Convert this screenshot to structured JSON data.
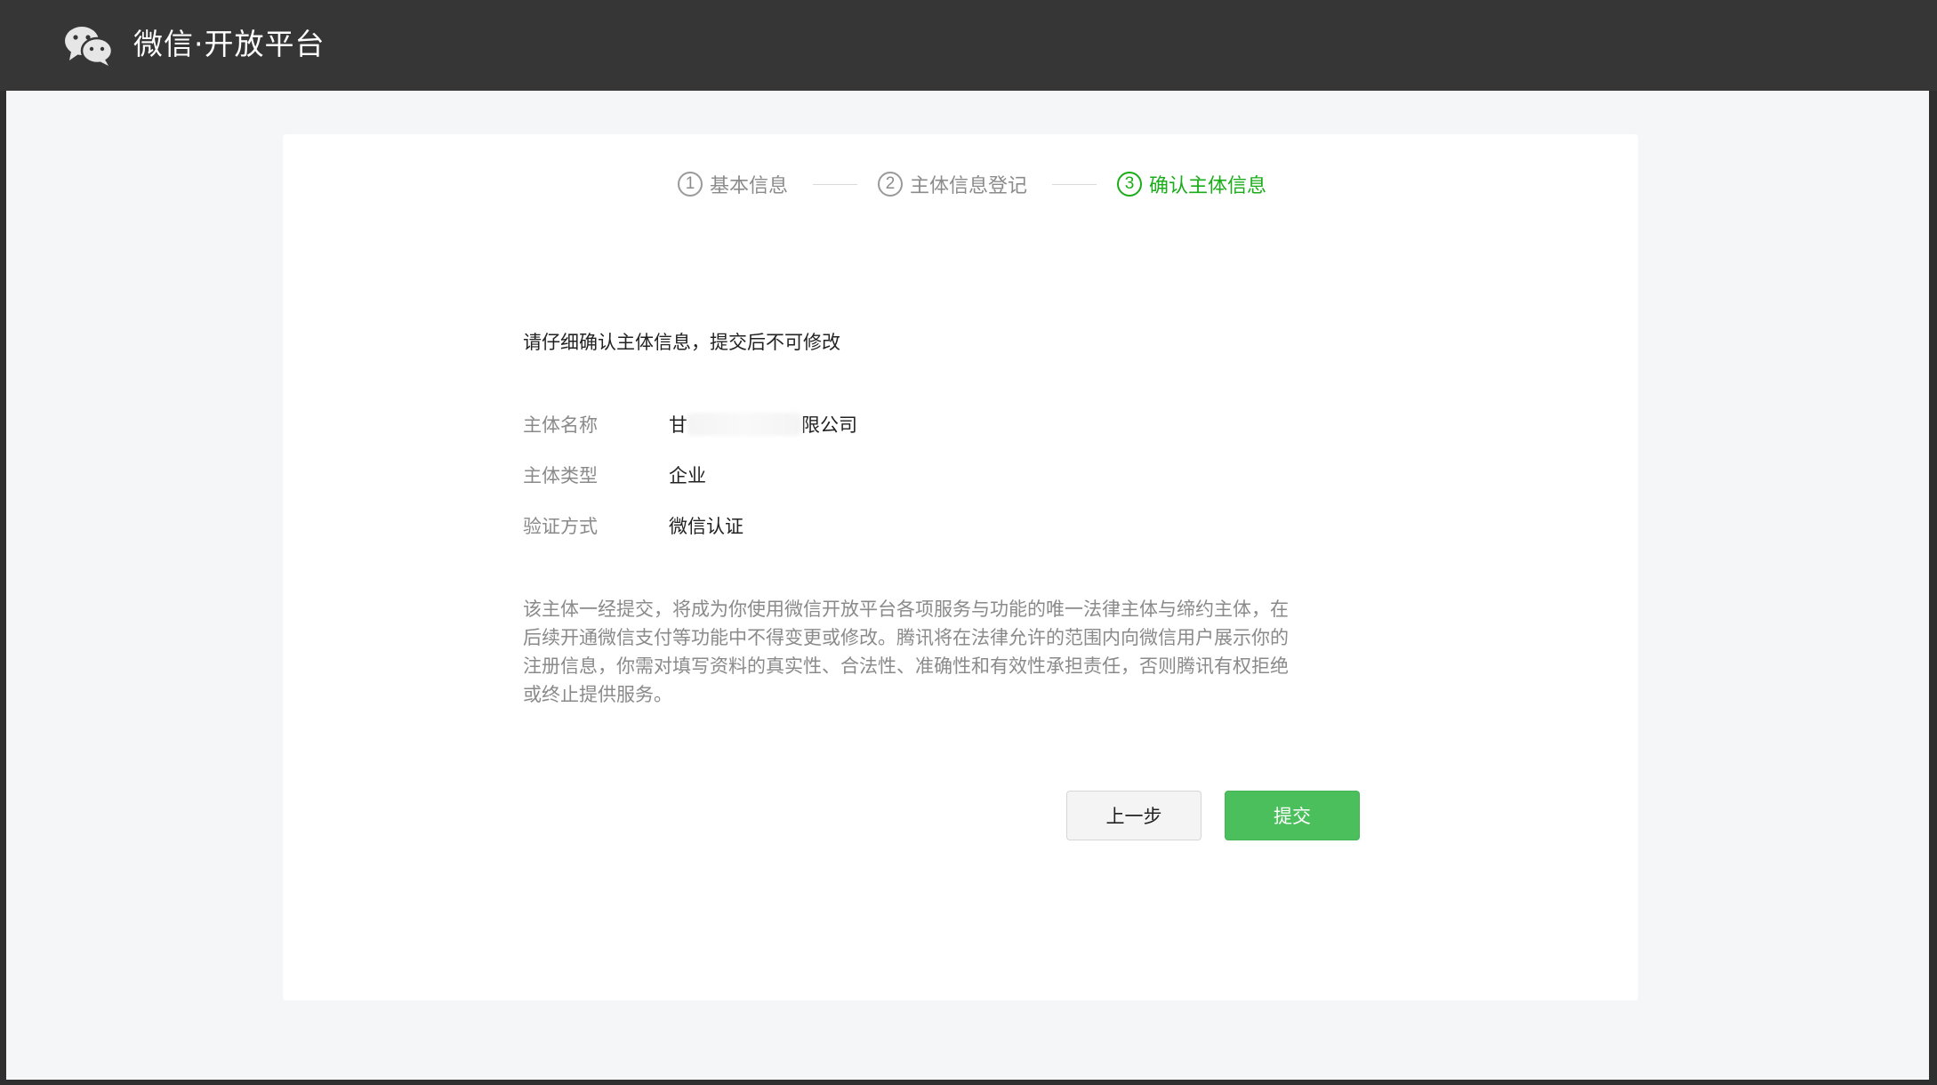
{
  "header": {
    "brand": "微信·开放平台",
    "logo_icon": "wechat-logo-icon"
  },
  "stepper": {
    "steps": [
      {
        "num": "1",
        "label": "基本信息",
        "state": "done"
      },
      {
        "num": "2",
        "label": "主体信息登记",
        "state": "done"
      },
      {
        "num": "3",
        "label": "确认主体信息",
        "state": "active"
      }
    ],
    "active_color": "#1aad19"
  },
  "confirm": {
    "notice": "请仔细确认主体信息，提交后不可修改",
    "fields": [
      {
        "label": "主体名称",
        "value_prefix": "甘",
        "value_suffix": "限公司"
      },
      {
        "label": "主体类型",
        "value": "企业"
      },
      {
        "label": "验证方式",
        "value": "微信认证"
      }
    ],
    "description": "该主体一经提交，将成为你使用微信开放平台各项服务与功能的唯一法律主体与缔约主体，在后续开通微信支付等功能中不得变更或修改。腾讯将在法律允许的范围内向微信用户展示你的注册信息，你需对填写资料的真实性、合法性、准确性和有效性承担责任，否则腾讯有权拒绝或终止提供服务。"
  },
  "actions": {
    "prev_label": "上一步",
    "submit_label": "提交",
    "submit_color": "#4cbf5d"
  }
}
